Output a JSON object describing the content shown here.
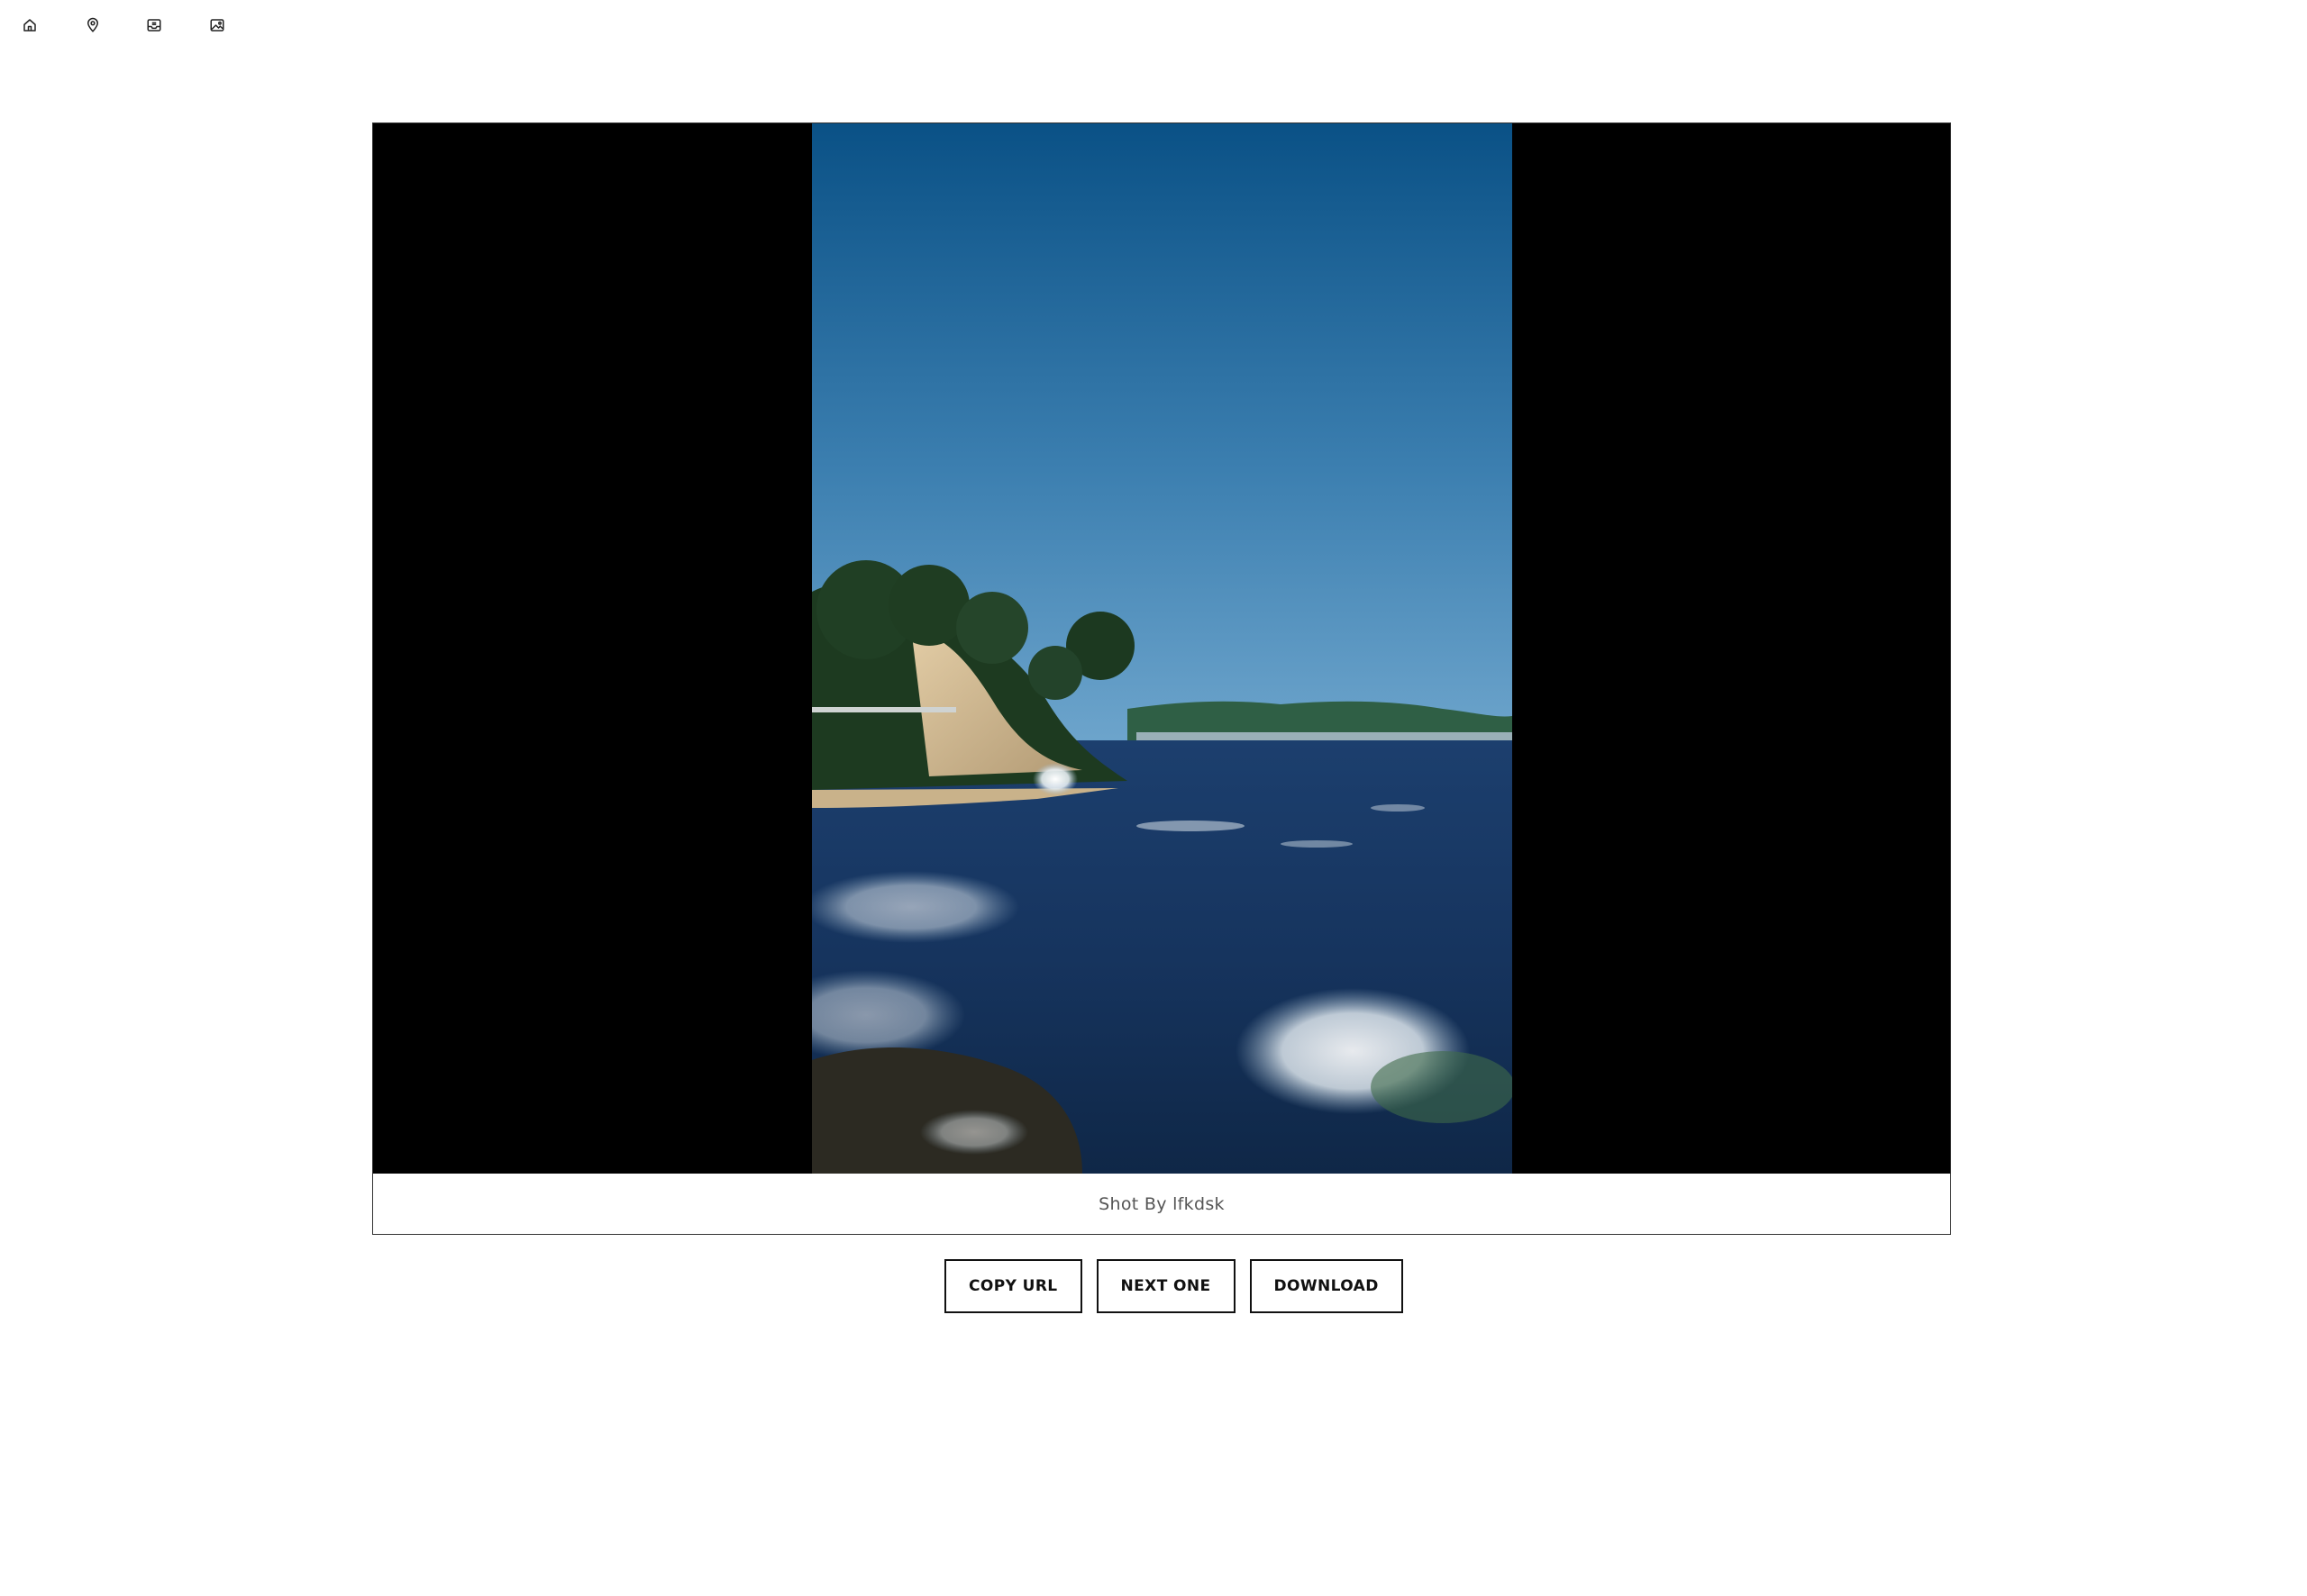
{
  "nav": {
    "icons": [
      "home-icon",
      "map-pin-icon",
      "inbox-icon",
      "image-icon"
    ]
  },
  "photo": {
    "caption": "Shot By lfkdsk"
  },
  "actions": {
    "copy_url": "COPY URL",
    "next_one": "NEXT ONE",
    "download": "DOWNLOAD"
  }
}
